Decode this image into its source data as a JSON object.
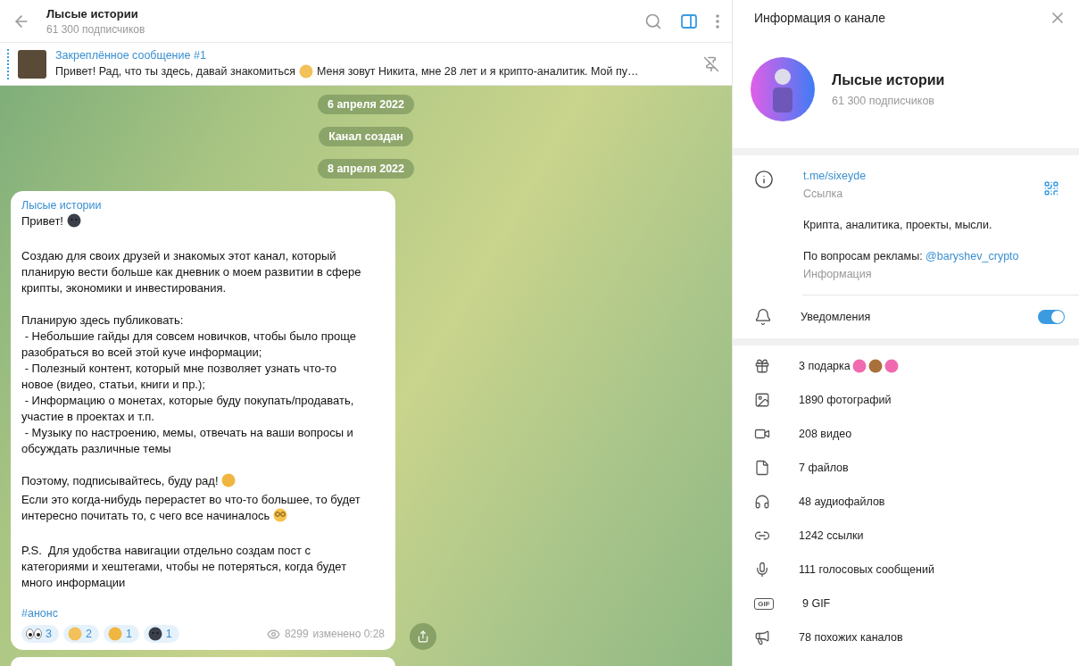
{
  "header": {
    "title": "Лысые истории",
    "subtitle": "61 300 подписчиков"
  },
  "pinned": {
    "title": "Закреплённое сообщение #1",
    "text_before": "Привет! Рад, что ты здесь, давай знакомиться",
    "text_after": "Меня зовут Никита, мне 28 лет и я крипто-аналитик.  Мой пу…"
  },
  "service_messages": [
    "6 апреля 2022",
    "Канал создан",
    "8 апреля 2022"
  ],
  "message": {
    "author": "Лысые истории",
    "paragraphs": [
      {
        "segments": [
          {
            "text": "Привет!",
            "kind": "moon"
          }
        ]
      },
      {
        "segments": [
          {
            "text": "Создаю для своих друзей и знакомых этот канал, который\nпланирую вести больше как дневник о моем развитии в сфере\nкрипты, экономики и инвестирования.",
            "kind": "plain"
          }
        ]
      },
      {
        "segments": [
          {
            "text": "Планирую здесь публиковать:\n - Небольшие гайды для совсем новичков, чтобы было проще\nразобраться во всей этой куче информации;\n - Полезный контент, который мне позволяет узнать что-то\nновое (видео, статьи, книги и пр.);\n - Информацию о монетах, которые буду покупать/продавать,\nучастие в проектах и т.п.\n - Музыку по настроению, мемы, отвечать на ваши вопросы и\nобсуждать различные темы",
            "kind": "plain"
          }
        ]
      },
      {
        "segments": [
          {
            "text": "Поэтому, подписывайтесь, буду рад!",
            "kind": "party"
          },
          {
            "text": "Если это когда-нибудь перерастет во что-то большее, то будет\nинтересно почитать то, с чего все начиналось",
            "kind": "nerd"
          }
        ]
      },
      {
        "segments": [
          {
            "text": "P.S.  Для удобства навигации отдельно создам пост с\nкатегориями и хештегами, чтобы не потеряться, когда будет\nмного информации",
            "kind": "plain"
          }
        ]
      }
    ],
    "hashtag": "#анонс",
    "reactions": [
      {
        "kind": "eyes",
        "count": "3"
      },
      {
        "kind": "handshake",
        "count": "2"
      },
      {
        "kind": "party",
        "count": "1"
      },
      {
        "kind": "moon",
        "count": "1"
      }
    ],
    "views": "8299",
    "edited": "изменено 0:28"
  },
  "panel": {
    "title": "Информация о канале",
    "name": "Лысые истории",
    "subscribers": "61 300 подписчиков",
    "link": "t.me/sixeyde",
    "link_label": "Ссылка",
    "description": "Крипта, аналитика, проекты, мысли.",
    "ads_text": "По вопросам рекламы:",
    "ads_link": "@baryshev_crypto",
    "info_label": "Информация",
    "notifications": {
      "label": "Уведомления",
      "on": true
    },
    "media": [
      {
        "kind": "gift",
        "text": "3 подарка",
        "emojis": [
          {
            "kind": "heart"
          },
          {
            "kind": "bear"
          },
          {
            "kind": "heart"
          }
        ]
      },
      {
        "kind": "photo",
        "text": "1890 фотографий"
      },
      {
        "kind": "video",
        "text": "208 видео"
      },
      {
        "kind": "file",
        "text": "7 файлов"
      },
      {
        "kind": "audio",
        "text": "48 аудиофайлов"
      },
      {
        "kind": "link",
        "text": "1242 ссылки"
      },
      {
        "kind": "mic",
        "text": "111 голосовых сообщений"
      },
      {
        "kind": "gif",
        "icon_text": "GIF",
        "text": "9 GIF"
      },
      {
        "kind": "megaphone",
        "text": "78 похожих каналов"
      }
    ]
  }
}
